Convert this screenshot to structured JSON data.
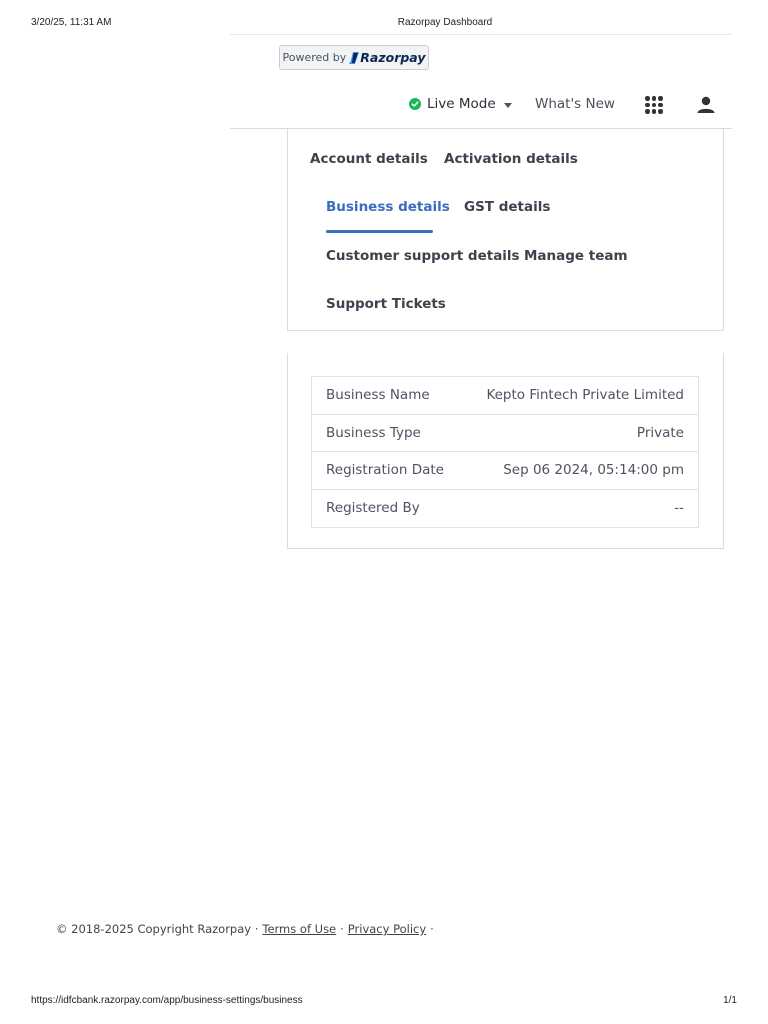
{
  "print": {
    "datetime": "3/20/25, 11:31 AM",
    "title": "Razorpay Dashboard",
    "url": "https://idfcbank.razorpay.com/app/business-settings/business",
    "page": "1/1"
  },
  "header": {
    "powered_by": "Powered by",
    "brand": "Razorpay",
    "mode_label": "Live Mode",
    "whats_new": "What's New",
    "mode_status_color": "#1bb55c"
  },
  "tabs": [
    {
      "label": "Account details",
      "active": false
    },
    {
      "label": "Activation details",
      "active": false
    },
    {
      "label": "Business details",
      "active": true
    },
    {
      "label": "GST details",
      "active": false
    },
    {
      "label": "Customer support details",
      "active": false
    },
    {
      "label": "Manage team",
      "active": false
    },
    {
      "label": "Support Tickets",
      "active": false
    }
  ],
  "details": [
    {
      "label": "Business Name",
      "value": "Kepto Fintech Private Limited"
    },
    {
      "label": "Business Type",
      "value": "Private"
    },
    {
      "label": "Registration Date",
      "value": "Sep 06 2024, 05:14:00 pm"
    },
    {
      "label": "Registered By",
      "value": "--"
    }
  ],
  "footer": {
    "copyright": "© 2018-2025 Copyright Razorpay ·",
    "terms": "Terms of Use",
    "sep": "·",
    "privacy": "Privacy Policy",
    "trail": "·"
  },
  "colors": {
    "accent": "#3a6dc0",
    "brand_navy": "#0c2651",
    "live_green": "#1bb55c"
  }
}
